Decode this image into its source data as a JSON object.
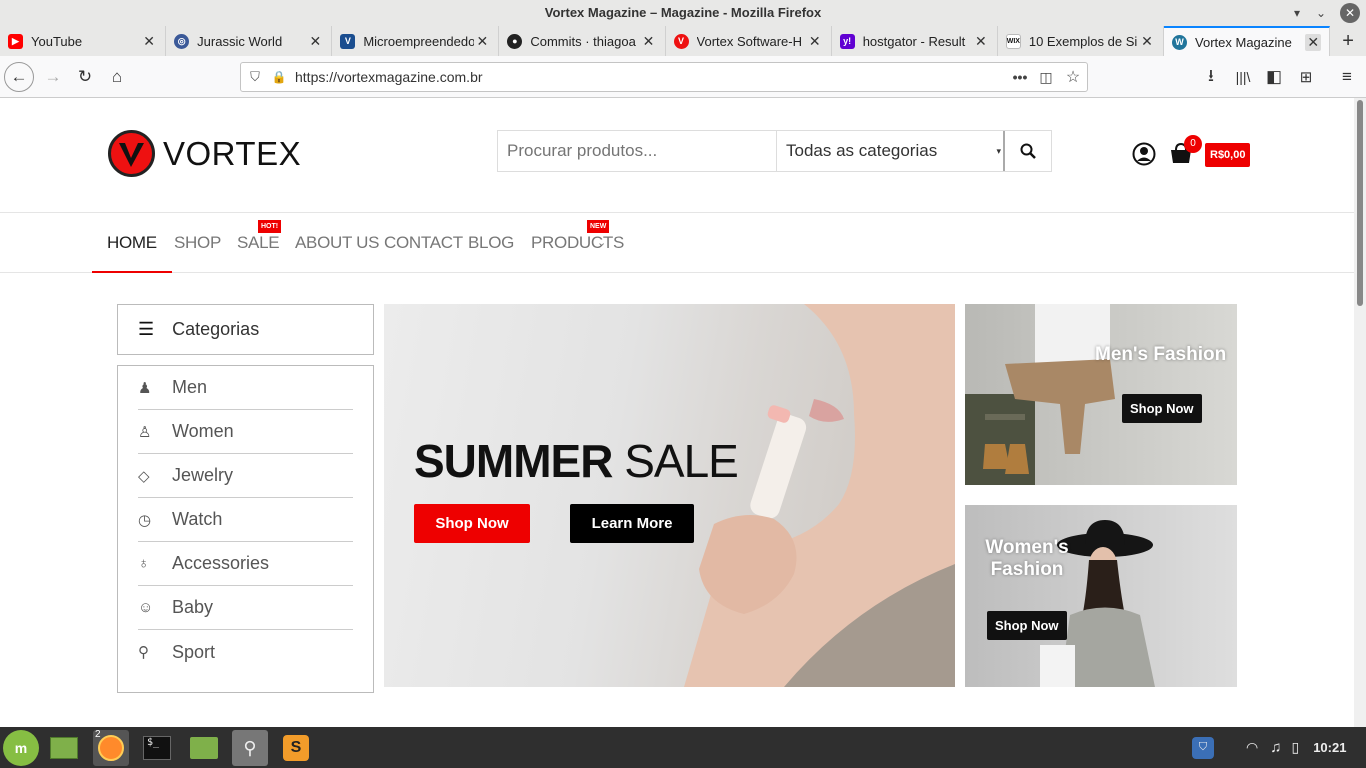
{
  "window": {
    "title": "Vortex Magazine – Magazine - Mozilla Firefox"
  },
  "tabs": [
    {
      "label": "YouTube",
      "icon": "youtube-icon",
      "color": "#ff0000"
    },
    {
      "label": "Jurassic World",
      "icon": "globe-icon",
      "color": "#3b5998"
    },
    {
      "label": "Microempreendedor",
      "icon": "v-icon",
      "color": "#1a4d8f"
    },
    {
      "label": "Commits · thiagoa",
      "icon": "github-icon",
      "color": "#222222"
    },
    {
      "label": "Vortex Software-H",
      "icon": "vortex-icon",
      "color": "#e11111"
    },
    {
      "label": "hostgator - Result",
      "icon": "yahoo-icon",
      "color": "#6001d2"
    },
    {
      "label": "10 Exemplos de Si",
      "icon": "wix-icon",
      "color": "#555555"
    },
    {
      "label": "Vortex Magazine",
      "icon": "wordpress-icon",
      "color": "#21759b"
    }
  ],
  "urlbar": {
    "url": "https://vortexmagazine.com.br"
  },
  "site": {
    "logo_text": "VORTEX",
    "search": {
      "placeholder": "Procurar produtos...",
      "category": "Todas as categorias"
    },
    "cart": {
      "count": "0",
      "total": "R$0,00"
    },
    "menu": [
      {
        "label": "HOME",
        "badge": ""
      },
      {
        "label": "SHOP",
        "badge": ""
      },
      {
        "label": "SALE",
        "badge": "HOT!"
      },
      {
        "label": "ABOUT US",
        "badge": ""
      },
      {
        "label": "CONTACT",
        "badge": ""
      },
      {
        "label": "BLOG",
        "badge": ""
      },
      {
        "label": "PRODUCTS",
        "badge": "NEW"
      }
    ],
    "categories_title": "Categorias",
    "categories": [
      {
        "label": "Men",
        "icon": "man-icon"
      },
      {
        "label": "Women",
        "icon": "woman-icon"
      },
      {
        "label": "Jewelry",
        "icon": "diamond-icon"
      },
      {
        "label": "Watch",
        "icon": "clock-icon"
      },
      {
        "label": "Accessories",
        "icon": "bulb-icon"
      },
      {
        "label": "Baby",
        "icon": "baby-icon"
      },
      {
        "label": "Sport",
        "icon": "bicycle-icon"
      }
    ],
    "banner": {
      "title_bold": "SUMMER",
      "title_light": "SALE",
      "shop_now": "Shop Now",
      "learn_more": "Learn More"
    },
    "mens": {
      "title": "Men's Fashion",
      "button": "Shop Now"
    },
    "womens": {
      "title": "Women's Fashion",
      "button": "Shop Now"
    },
    "accent_color": "#ee0000"
  },
  "taskbar": {
    "firefox_badge": "2",
    "clock": "10:21"
  }
}
